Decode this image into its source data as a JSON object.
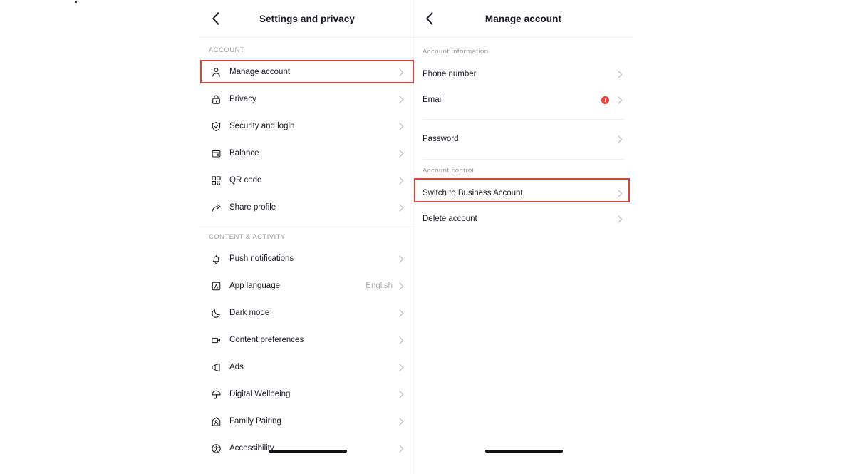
{
  "left_panel": {
    "header": {
      "back_icon": "chevron-left-icon",
      "title": "Settings and privacy"
    },
    "sections": [
      {
        "label": "ACCOUNT",
        "items": [
          {
            "icon": "person-icon",
            "label": "Manage account",
            "value": "",
            "chevron": "chevron-right-icon",
            "highlighted": true
          },
          {
            "icon": "lock-icon",
            "label": "Privacy",
            "value": "",
            "chevron": "chevron-right-icon"
          },
          {
            "icon": "shield-check-icon",
            "label": "Security and login",
            "value": "",
            "chevron": "chevron-right-icon"
          },
          {
            "icon": "wallet-icon",
            "label": "Balance",
            "value": "",
            "chevron": "chevron-right-icon"
          },
          {
            "icon": "qr-code-icon",
            "label": "QR code",
            "value": "",
            "chevron": "chevron-right-icon"
          },
          {
            "icon": "share-arrow-icon",
            "label": "Share profile",
            "value": "",
            "chevron": "chevron-right-icon"
          }
        ]
      },
      {
        "label": "CONTENT & ACTIVITY",
        "items": [
          {
            "icon": "bell-icon",
            "label": "Push notifications",
            "value": "",
            "chevron": "chevron-right-icon"
          },
          {
            "icon": "language-a-icon",
            "label": "App language",
            "value": "English",
            "chevron": "chevron-right-icon"
          },
          {
            "icon": "moon-icon",
            "label": "Dark mode",
            "value": "",
            "chevron": "chevron-right-icon"
          },
          {
            "icon": "video-camera-icon",
            "label": "Content preferences",
            "value": "",
            "chevron": "chevron-right-icon"
          },
          {
            "icon": "megaphone-icon",
            "label": "Ads",
            "value": "",
            "chevron": "chevron-right-icon"
          },
          {
            "icon": "umbrella-icon",
            "label": "Digital Wellbeing",
            "value": "",
            "chevron": "chevron-right-icon"
          },
          {
            "icon": "family-home-icon",
            "label": "Family Pairing",
            "value": "",
            "chevron": "chevron-right-icon"
          },
          {
            "icon": "accessibility-icon",
            "label": "Accessibility",
            "value": "",
            "chevron": "chevron-right-icon"
          }
        ]
      }
    ]
  },
  "right_panel": {
    "header": {
      "back_icon": "chevron-left-icon",
      "title": "Manage account"
    },
    "sections": [
      {
        "label": "Account information",
        "items": [
          {
            "label": "Phone number",
            "badge": "",
            "chevron": "chevron-right-icon"
          },
          {
            "label": "Email",
            "badge": "!",
            "chevron": "chevron-right-icon"
          }
        ]
      },
      {
        "label": "",
        "items": [
          {
            "label": "Password",
            "badge": "",
            "chevron": "chevron-right-icon"
          }
        ]
      },
      {
        "label": "Account control",
        "items": [
          {
            "label": "Switch to Business Account",
            "badge": "",
            "chevron": "chevron-right-icon",
            "highlighted": true
          },
          {
            "label": "Delete account",
            "badge": "",
            "chevron": "chevron-right-icon"
          }
        ]
      }
    ]
  },
  "annotations": {
    "highlight_color": "#d8463c",
    "boxes": [
      {
        "name": "manage-account-highlight",
        "target": "Manage account"
      },
      {
        "name": "switch-business-highlight",
        "target": "Switch to Business Account"
      }
    ]
  },
  "colors": {
    "text_primary": "#161823",
    "text_muted": "#9b9ba1",
    "chevron": "#c4c4c8",
    "warning_red": "#e8443a",
    "highlight_red": "#d8463c",
    "background": "#ffffff"
  }
}
